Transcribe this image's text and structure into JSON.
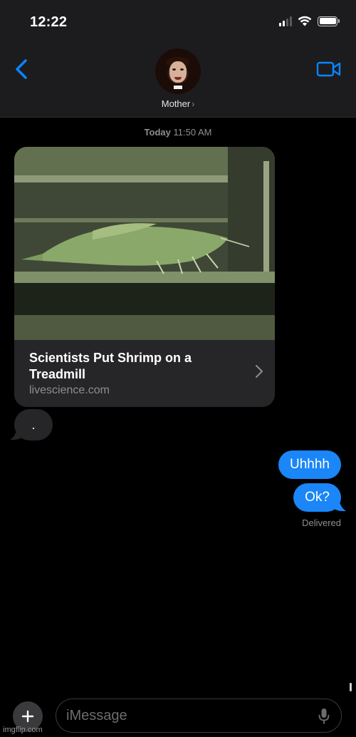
{
  "status_bar": {
    "time": "12:22",
    "icons": [
      "signal-icon",
      "wifi-icon",
      "battery-icon"
    ]
  },
  "header": {
    "back_icon": "chevron-left-icon",
    "video_icon": "video-camera-icon",
    "contact_name": "Mother",
    "contact_chevron": "›"
  },
  "conversation": {
    "timestamp_day": "Today",
    "timestamp_time": "11:50 AM",
    "link_preview": {
      "title": "Scientists Put Shrimp on a Treadmill",
      "domain": "livescience.com",
      "image_icon": "shrimp-treadmill-image"
    },
    "messages": [
      {
        "direction": "incoming",
        "text": "."
      },
      {
        "direction": "outgoing",
        "text": "Uhhhh"
      },
      {
        "direction": "outgoing",
        "text": "Ok?"
      }
    ],
    "delivery_status": "Delivered"
  },
  "compose": {
    "placeholder": "iMessage",
    "plus_icon": "plus-icon",
    "mic_icon": "microphone-icon"
  },
  "watermark": "imgflip.com",
  "colors": {
    "accent": "#0a84ff",
    "outgoing_bubble": "#1a86f7",
    "incoming_bubble": "#262628",
    "header_bg": "#1c1c1e"
  }
}
